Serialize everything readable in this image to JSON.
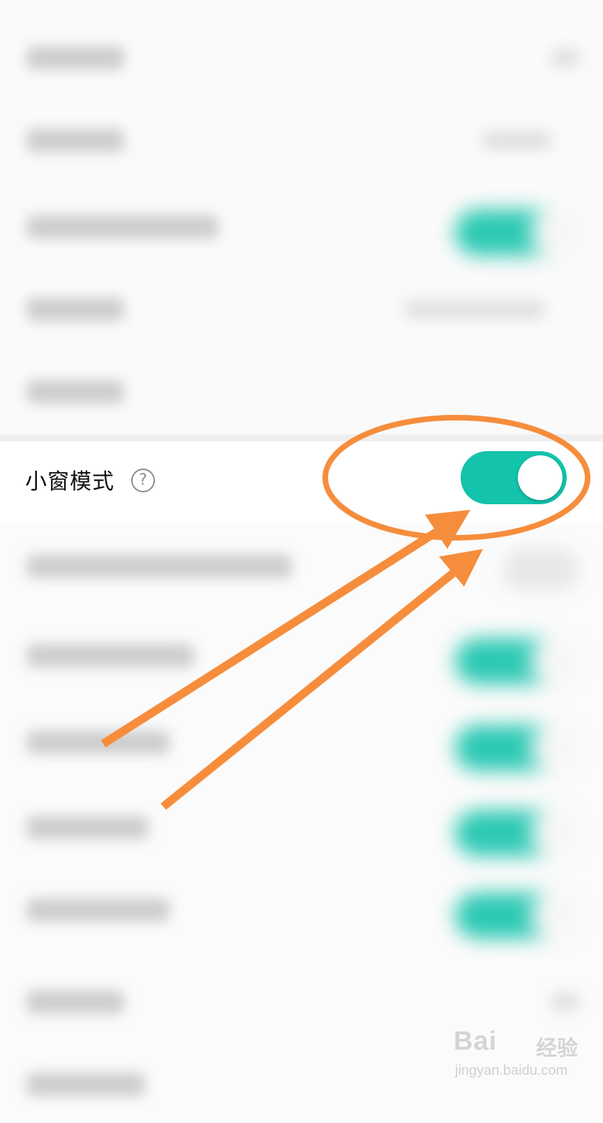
{
  "settings": {
    "highlighted_item": {
      "label": "小窗模式",
      "help_glyph": "?",
      "toggle_state": "on"
    }
  },
  "colors": {
    "toggle_on": "#13c3ab",
    "annotation": "#f68d3c"
  },
  "icons": {
    "help": "question-circle-icon"
  },
  "watermark": {
    "brand_text": "Bai",
    "brand_suffix": "经验",
    "url": "jingyan.baidu.com"
  }
}
